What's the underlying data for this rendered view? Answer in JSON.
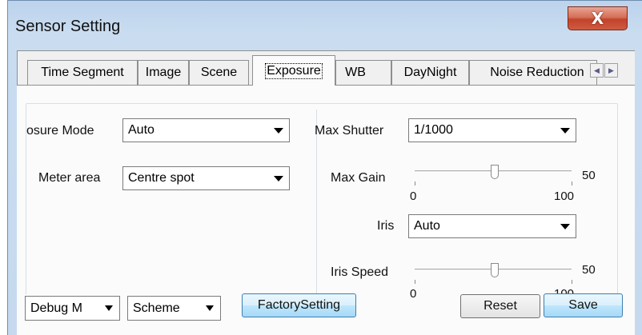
{
  "window": {
    "title": "Sensor Setting",
    "close_glyph": "X"
  },
  "tabs": [
    {
      "label": "Time Segment"
    },
    {
      "label": "Image"
    },
    {
      "label": "Scene"
    },
    {
      "label": "Exposure",
      "active": true
    },
    {
      "label": "WB"
    },
    {
      "label": "DayNight"
    },
    {
      "label": "Noise Reduction"
    }
  ],
  "tab_scroll": {
    "left_icon": "arrow-left-icon",
    "left_glyph": "◀",
    "right_icon": "arrow-right-icon",
    "right_glyph": "▶"
  },
  "exposure": {
    "exposure_mode": {
      "label": "osure Mode",
      "value": "Auto"
    },
    "meter_area": {
      "label": "Meter area",
      "value": "Centre spot"
    },
    "max_shutter": {
      "label": "Max Shutter",
      "value": "1/1000"
    },
    "max_gain": {
      "label": "Max Gain",
      "value": "50",
      "min": "0",
      "max": "100",
      "level": 0.5
    },
    "iris": {
      "label": "Iris",
      "value": "Auto"
    },
    "iris_speed": {
      "label": "Iris Speed",
      "value": "50",
      "min": "0",
      "max": "100",
      "level": 0.5
    }
  },
  "bottom": {
    "debug_mode": "Debug M",
    "scheme": "Scheme",
    "factory_setting": "FactorySetting",
    "reset": "Reset",
    "save": "Save"
  }
}
